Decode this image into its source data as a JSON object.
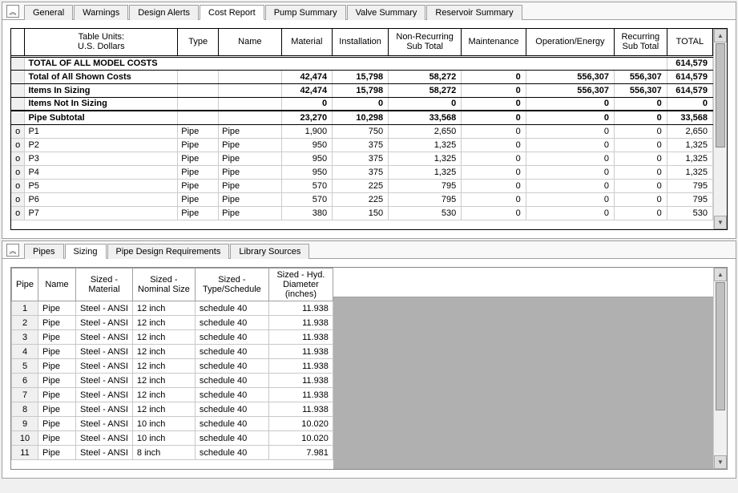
{
  "top": {
    "tabs": [
      "General",
      "Warnings",
      "Design Alerts",
      "Cost Report",
      "Pump Summary",
      "Valve Summary",
      "Reservoir Summary"
    ],
    "active_tab": 3,
    "table_units_label": "Table Units:\nU.S. Dollars",
    "headers": {
      "type": "Type",
      "name": "Name",
      "material": "Material",
      "installation": "Installation",
      "nonrecurring": "Non-Recurring\nSub Total",
      "maintenance": "Maintenance",
      "opEnergy": "Operation/Energy",
      "recurring": "Recurring\nSub Total",
      "total": "TOTAL"
    },
    "title_row": {
      "label": "TOTAL OF ALL MODEL COSTS",
      "total": "614,579"
    },
    "summary": [
      {
        "label": "Total of All Shown Costs",
        "material": "42,474",
        "installation": "15,798",
        "nr": "58,272",
        "maint": "0",
        "op": "556,307",
        "rec": "556,307",
        "total": "614,579"
      },
      {
        "label": "Items In Sizing",
        "material": "42,474",
        "installation": "15,798",
        "nr": "58,272",
        "maint": "0",
        "op": "556,307",
        "rec": "556,307",
        "total": "614,579"
      },
      {
        "label": "Items Not In Sizing",
        "material": "0",
        "installation": "0",
        "nr": "0",
        "maint": "0",
        "op": "0",
        "rec": "0",
        "total": "0"
      }
    ],
    "subtotal": {
      "label": "Pipe Subtotal",
      "material": "23,270",
      "installation": "10,298",
      "nr": "33,568",
      "maint": "0",
      "op": "0",
      "rec": "0",
      "total": "33,568"
    },
    "rows": [
      {
        "mark": "o",
        "id": "P1",
        "type": "Pipe",
        "name": "Pipe",
        "material": "1,900",
        "installation": "750",
        "nr": "2,650",
        "maint": "0",
        "op": "0",
        "rec": "0",
        "total": "2,650"
      },
      {
        "mark": "o",
        "id": "P2",
        "type": "Pipe",
        "name": "Pipe",
        "material": "950",
        "installation": "375",
        "nr": "1,325",
        "maint": "0",
        "op": "0",
        "rec": "0",
        "total": "1,325"
      },
      {
        "mark": "o",
        "id": "P3",
        "type": "Pipe",
        "name": "Pipe",
        "material": "950",
        "installation": "375",
        "nr": "1,325",
        "maint": "0",
        "op": "0",
        "rec": "0",
        "total": "1,325"
      },
      {
        "mark": "o",
        "id": "P4",
        "type": "Pipe",
        "name": "Pipe",
        "material": "950",
        "installation": "375",
        "nr": "1,325",
        "maint": "0",
        "op": "0",
        "rec": "0",
        "total": "1,325"
      },
      {
        "mark": "o",
        "id": "P5",
        "type": "Pipe",
        "name": "Pipe",
        "material": "570",
        "installation": "225",
        "nr": "795",
        "maint": "0",
        "op": "0",
        "rec": "0",
        "total": "795"
      },
      {
        "mark": "o",
        "id": "P6",
        "type": "Pipe",
        "name": "Pipe",
        "material": "570",
        "installation": "225",
        "nr": "795",
        "maint": "0",
        "op": "0",
        "rec": "0",
        "total": "795"
      },
      {
        "mark": "o",
        "id": "P7",
        "type": "Pipe",
        "name": "Pipe",
        "material": "380",
        "installation": "150",
        "nr": "530",
        "maint": "0",
        "op": "0",
        "rec": "0",
        "total": "530"
      }
    ]
  },
  "bottom": {
    "tabs": [
      "Pipes",
      "Sizing",
      "Pipe Design Requirements",
      "Library Sources"
    ],
    "active_tab": 1,
    "headers": {
      "pipe": "Pipe",
      "name": "Name",
      "material": "Sized -\nMaterial",
      "nominal": "Sized -\nNominal Size",
      "schedule": "Sized -\nType/Schedule",
      "diameter": "Sized - Hyd.\nDiameter\n(inches)"
    },
    "rows": [
      {
        "n": "1",
        "name": "Pipe",
        "mat": "Steel - ANSI",
        "nom": "12 inch",
        "sch": "schedule 40",
        "dia": "11.938"
      },
      {
        "n": "2",
        "name": "Pipe",
        "mat": "Steel - ANSI",
        "nom": "12 inch",
        "sch": "schedule 40",
        "dia": "11.938"
      },
      {
        "n": "3",
        "name": "Pipe",
        "mat": "Steel - ANSI",
        "nom": "12 inch",
        "sch": "schedule 40",
        "dia": "11.938"
      },
      {
        "n": "4",
        "name": "Pipe",
        "mat": "Steel - ANSI",
        "nom": "12 inch",
        "sch": "schedule 40",
        "dia": "11.938"
      },
      {
        "n": "5",
        "name": "Pipe",
        "mat": "Steel - ANSI",
        "nom": "12 inch",
        "sch": "schedule 40",
        "dia": "11.938"
      },
      {
        "n": "6",
        "name": "Pipe",
        "mat": "Steel - ANSI",
        "nom": "12 inch",
        "sch": "schedule 40",
        "dia": "11.938"
      },
      {
        "n": "7",
        "name": "Pipe",
        "mat": "Steel - ANSI",
        "nom": "12 inch",
        "sch": "schedule 40",
        "dia": "11.938"
      },
      {
        "n": "8",
        "name": "Pipe",
        "mat": "Steel - ANSI",
        "nom": "12 inch",
        "sch": "schedule 40",
        "dia": "11.938"
      },
      {
        "n": "9",
        "name": "Pipe",
        "mat": "Steel - ANSI",
        "nom": "10 inch",
        "sch": "schedule 40",
        "dia": "10.020"
      },
      {
        "n": "10",
        "name": "Pipe",
        "mat": "Steel - ANSI",
        "nom": "10 inch",
        "sch": "schedule 40",
        "dia": "10.020"
      },
      {
        "n": "11",
        "name": "Pipe",
        "mat": "Steel - ANSI",
        "nom": "8 inch",
        "sch": "schedule 40",
        "dia": "7.981"
      }
    ]
  }
}
